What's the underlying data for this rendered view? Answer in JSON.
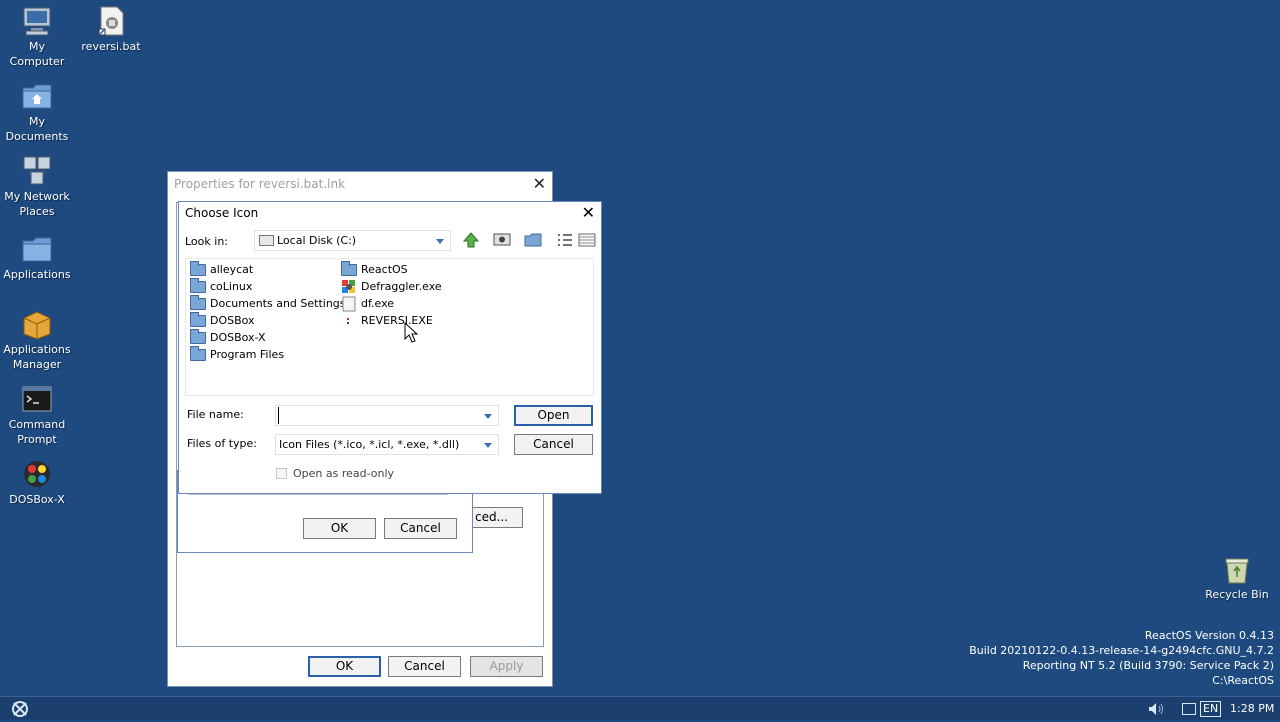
{
  "desktop": {
    "icons": [
      {
        "label": "My Computer"
      },
      {
        "label": "reversi.bat"
      },
      {
        "label": "My Documents"
      },
      {
        "label": "My Network Places"
      },
      {
        "label": "Applications"
      },
      {
        "label": "Applications Manager"
      },
      {
        "label": "Command Prompt"
      },
      {
        "label": "DOSBox-X"
      },
      {
        "label": "Recycle Bin"
      }
    ],
    "version": {
      "line1": "ReactOS Version 0.4.13",
      "line2": "Build 20210122-0.4.13-release-14-g2494cfc.GNU_4.7.2",
      "line3": "Reporting NT 5.2 (Build 3790: Service Pack 2)",
      "line4": "C:\\ReactOS"
    }
  },
  "properties_window": {
    "title": "Properties for reversi.bat.lnk",
    "ok_label": "OK",
    "cancel_label": "Cancel",
    "apply_label": "Apply",
    "advanced_label": "ced..."
  },
  "change_icon_dialog": {
    "ok_label": "OK",
    "cancel_label": "Cancel"
  },
  "choose_icon": {
    "title": "Choose Icon",
    "look_in_label": "Look in:",
    "look_in_value": "Local Disk (C:)",
    "files": [
      {
        "name": "alleycat",
        "kind": "folder"
      },
      {
        "name": "coLinux",
        "kind": "folder"
      },
      {
        "name": "Documents and Settings",
        "kind": "folder"
      },
      {
        "name": "DOSBox",
        "kind": "folder"
      },
      {
        "name": "DOSBox-X",
        "kind": "folder"
      },
      {
        "name": "Program Files",
        "kind": "folder"
      },
      {
        "name": "ReactOS",
        "kind": "folder"
      },
      {
        "name": "Defraggler.exe",
        "kind": "exe"
      },
      {
        "name": "df.exe",
        "kind": "exe"
      },
      {
        "name": "REVERSI.EXE",
        "kind": "exe"
      }
    ],
    "file_name_label": "File name:",
    "file_name_value": "",
    "files_of_type_label": "Files of type:",
    "files_of_type_value": "Icon Files (*.ico, *.icl, *.exe, *.dll)",
    "readonly_label": "Open as read-only",
    "open_label": "Open",
    "cancel_label": "Cancel"
  },
  "taskbar": {
    "clock": "1:28 PM",
    "language": "EN"
  }
}
